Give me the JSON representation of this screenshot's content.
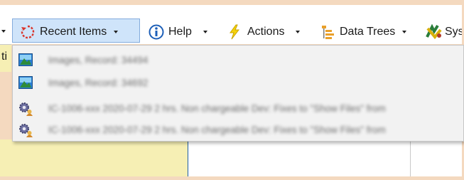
{
  "toolbar": {
    "recent_items": "Recent Items",
    "help": "Help",
    "actions": "Actions",
    "data_trees": "Data Trees",
    "system_partial": "Sys"
  },
  "left_strip_text": "ti",
  "recent_menu": {
    "items": [
      {
        "icon": "image-record-icon",
        "text": "Images, Record: 34494"
      },
      {
        "icon": "image-record-icon",
        "text": "Images, Record: 34692"
      },
      {
        "icon": "gears-user-icon",
        "text": "IC-1006-xxx 2020-07-29 2 hrs. Non chargeable Dev: Fixes to \"Show Files\" from"
      },
      {
        "icon": "gears-user-icon",
        "text": "IC-1006-xxx 2020-07-29 2 hrs. Non chargeable Dev: Fixes to \"Show Files\" from"
      }
    ]
  }
}
